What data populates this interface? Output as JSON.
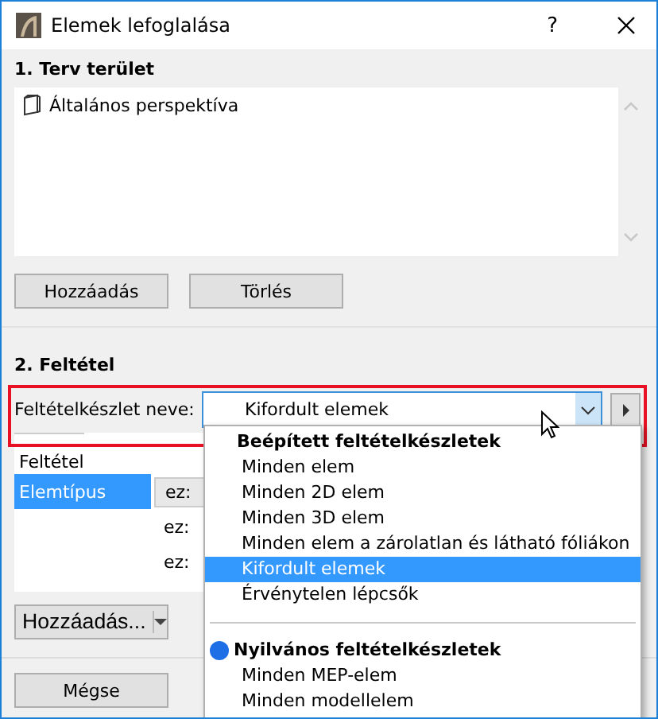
{
  "window": {
    "title": "Elemek lefoglalása",
    "help": "?"
  },
  "section1": {
    "heading": "1. Terv terület",
    "items": [
      {
        "label": "Általános perspektíva"
      }
    ],
    "buttons": [
      "Hozzáadás",
      "Törlés"
    ]
  },
  "section2": {
    "heading": "2. Feltétel",
    "combo_label": "Feltételkészlet neve:",
    "combo_value": "Kifordult elemek",
    "table": {
      "header": "Feltétel",
      "rows": [
        {
          "column_1": "Elemtípus",
          "column_2": "ez:",
          "selected": true
        },
        {
          "column_1": "",
          "column_2": "ez:",
          "selected": false
        },
        {
          "column_1": "",
          "column_2": "ez:",
          "selected": false
        }
      ]
    },
    "buttons": [
      "Hozzáadás..."
    ]
  },
  "dropdown": {
    "groups": [
      {
        "title": "Beépített feltételkészletek",
        "kind": "builtin",
        "items": [
          {
            "label": "Minden elem",
            "selected": false
          },
          {
            "label": "Minden 2D elem",
            "selected": false
          },
          {
            "label": "Minden 3D elem",
            "selected": false
          },
          {
            "label": "Minden elem a zárolatlan és látható fóliákon",
            "selected": false
          },
          {
            "label": "Kifordult elemek",
            "selected": true
          },
          {
            "label": "Érvénytelen lépcsők",
            "selected": false
          }
        ]
      },
      {
        "title": "Nyilvános feltételkészletek",
        "kind": "public",
        "items": [
          {
            "label": "Minden MEP-elem",
            "selected": false
          },
          {
            "label": "Minden modellelem",
            "selected": false
          }
        ]
      }
    ]
  },
  "footer": {
    "buttons": [
      "Mégse"
    ]
  }
}
